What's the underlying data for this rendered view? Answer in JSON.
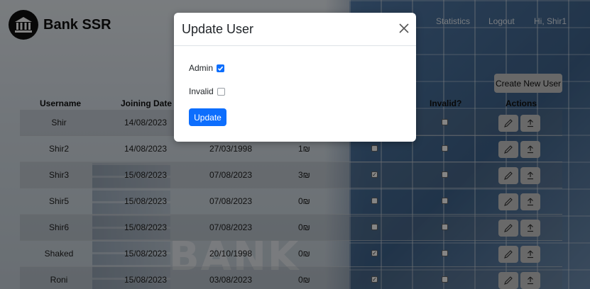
{
  "app": {
    "brand": "Bank SSR",
    "nav": {
      "statistics": "Statistics",
      "logout": "Logout",
      "greeting": "Hi, Shir1"
    }
  },
  "table": {
    "create_button": "Create New User",
    "headers": {
      "username": "Username",
      "joining_date": "Joining Date",
      "invalid": "Invalid?",
      "actions": "Actions"
    },
    "rows": [
      {
        "username": "Shir",
        "joining": "14/08/2023",
        "birth": "",
        "balance": "",
        "admin": false,
        "invalid": false
      },
      {
        "username": "Shir2",
        "joining": "14/08/2023",
        "birth": "27/03/1998",
        "balance": "1₪",
        "admin": false,
        "invalid": false
      },
      {
        "username": "Shir3",
        "joining": "15/08/2023",
        "birth": "07/08/2023",
        "balance": "3₪",
        "admin": true,
        "invalid": false
      },
      {
        "username": "Shir5",
        "joining": "15/08/2023",
        "birth": "07/08/2023",
        "balance": "0₪",
        "admin": false,
        "invalid": false
      },
      {
        "username": "Shir6",
        "joining": "15/08/2023",
        "birth": "07/08/2023",
        "balance": "0₪",
        "admin": false,
        "invalid": false
      },
      {
        "username": "Shaked",
        "joining": "15/08/2023",
        "birth": "20/10/1998",
        "balance": "0₪",
        "admin": true,
        "invalid": false
      },
      {
        "username": "Roni",
        "joining": "15/08/2023",
        "birth": "03/08/2023",
        "balance": "0₪",
        "admin": true,
        "invalid": false
      }
    ]
  },
  "modal": {
    "title": "Update User",
    "admin_label": "Admin",
    "admin_checked": true,
    "invalid_label": "Invalid",
    "invalid_checked": false,
    "update_button": "Update"
  },
  "icons": {
    "logo": "bank-icon",
    "close": "close-icon",
    "edit": "pencil-icon",
    "upload": "upload-icon"
  },
  "colors": {
    "primary": "#0d6efd"
  }
}
